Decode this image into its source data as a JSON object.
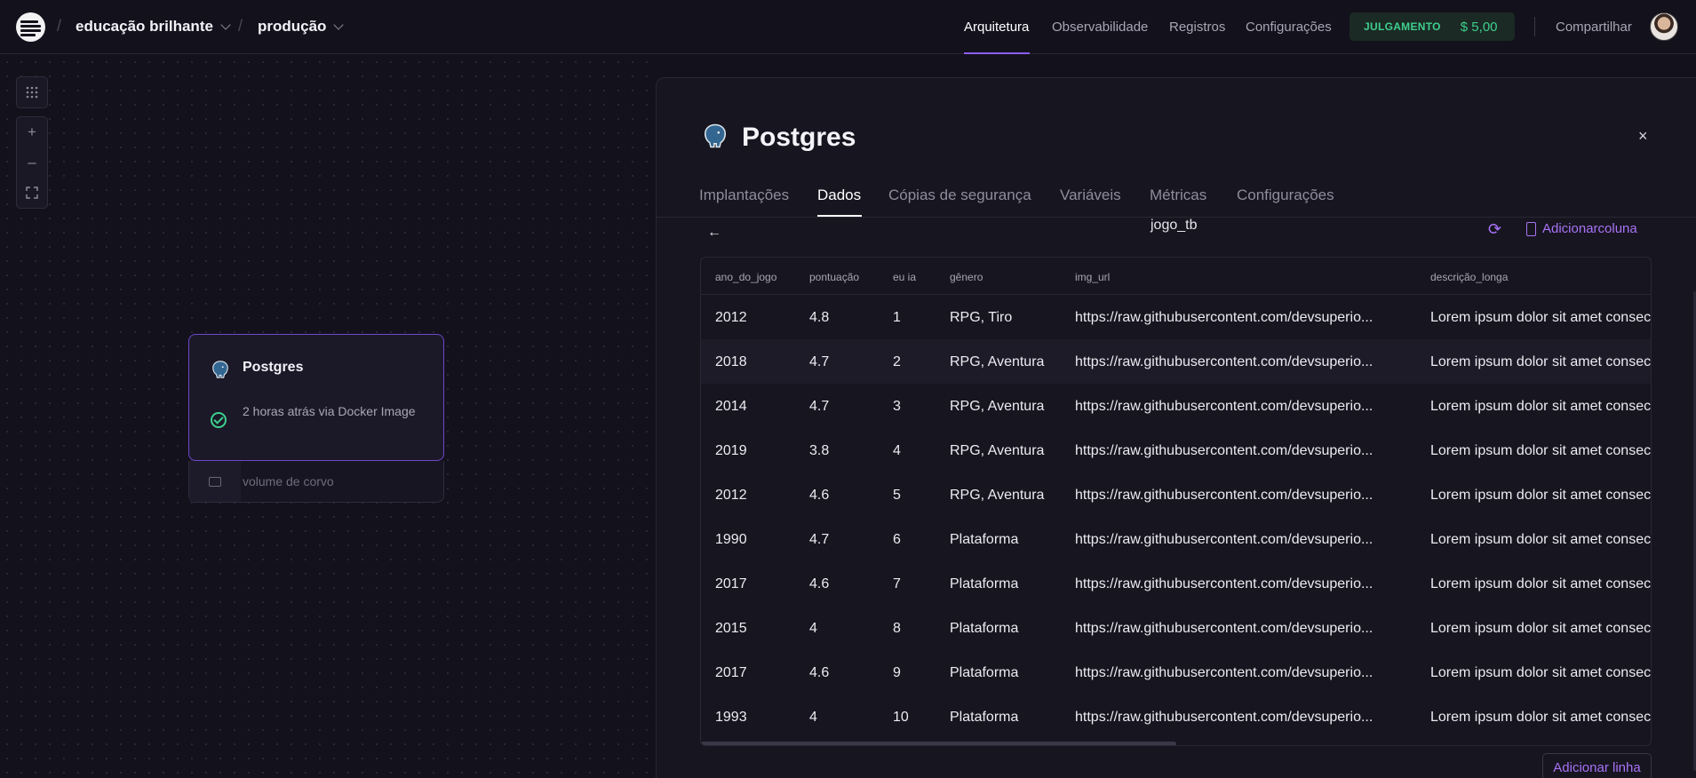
{
  "header": {
    "project": "educação brilhante",
    "environment": "produção",
    "nav": [
      "Arquitetura",
      "Observabilidade",
      "Registros",
      "Configurações"
    ],
    "trial_label": "JULGAMENTO",
    "trial_amount": "$ 5,00",
    "share_label": "Compartilhar"
  },
  "canvas": {
    "service_name": "Postgres",
    "service_status": "2 horas atrás via Docker Image",
    "volume_name": "volume de corvo",
    "zoom_in": "+",
    "zoom_out": "–"
  },
  "panel": {
    "title": "Postgres",
    "close": "×",
    "tabs": [
      "Implantações",
      "Dados",
      "Cópias de segurança",
      "Variáveis",
      "Métricas",
      "Configurações"
    ],
    "active_tab": "Dados",
    "back": "←",
    "table_name": "jogo_tb",
    "refresh": "⟳",
    "add_column_label": "Adicionarcoluna",
    "add_row_label": "Adicionar linha",
    "columns": [
      "ano_do_jogo",
      "pontuação",
      "eu ia",
      "gênero",
      "img_url",
      "descrição_longa"
    ],
    "rows": [
      [
        "2012",
        "4.8",
        "1",
        "RPG, Tiro",
        "https://raw.githubusercontent.com/devsuperio...",
        "Lorem ipsum dolor sit amet consectetur"
      ],
      [
        "2018",
        "4.7",
        "2",
        "RPG, Aventura",
        "https://raw.githubusercontent.com/devsuperio...",
        "Lorem ipsum dolor sit amet consectetur"
      ],
      [
        "2014",
        "4.7",
        "3",
        "RPG, Aventura",
        "https://raw.githubusercontent.com/devsuperio...",
        "Lorem ipsum dolor sit amet consectetur"
      ],
      [
        "2019",
        "3.8",
        "4",
        "RPG, Aventura",
        "https://raw.githubusercontent.com/devsuperio...",
        "Lorem ipsum dolor sit amet consectetur"
      ],
      [
        "2012",
        "4.6",
        "5",
        "RPG, Aventura",
        "https://raw.githubusercontent.com/devsuperio...",
        "Lorem ipsum dolor sit amet consectetur"
      ],
      [
        "1990",
        "4.7",
        "6",
        "Plataforma",
        "https://raw.githubusercontent.com/devsuperio...",
        "Lorem ipsum dolor sit amet consectetur"
      ],
      [
        "2017",
        "4.6",
        "7",
        "Plataforma",
        "https://raw.githubusercontent.com/devsuperio...",
        "Lorem ipsum dolor sit amet consectetur"
      ],
      [
        "2015",
        "4",
        "8",
        "Plataforma",
        "https://raw.githubusercontent.com/devsuperio...",
        "Lorem ipsum dolor sit amet consectetur"
      ],
      [
        "2017",
        "4.6",
        "9",
        "Plataforma",
        "https://raw.githubusercontent.com/devsuperio...",
        "Lorem ipsum dolor sit amet consectetur"
      ],
      [
        "1993",
        "4",
        "10",
        "Plataforma",
        "https://raw.githubusercontent.com/devsuperio...",
        "Lorem ipsum dolor sit amet consectetur"
      ]
    ]
  },
  "colors": {
    "accent": "#8b5cf6",
    "link": "#a873f7",
    "success": "#3ecf8e",
    "background": "#13111c"
  },
  "icons": [
    "railway-logo-icon",
    "chevron-down-icon",
    "grid-icon",
    "plus-icon",
    "minus-icon",
    "fit-view-icon",
    "postgres-elephant-icon",
    "check-circle-icon",
    "volume-icon",
    "close-icon",
    "arrow-left-icon",
    "refresh-icon",
    "add-column-icon",
    "avatar"
  ]
}
